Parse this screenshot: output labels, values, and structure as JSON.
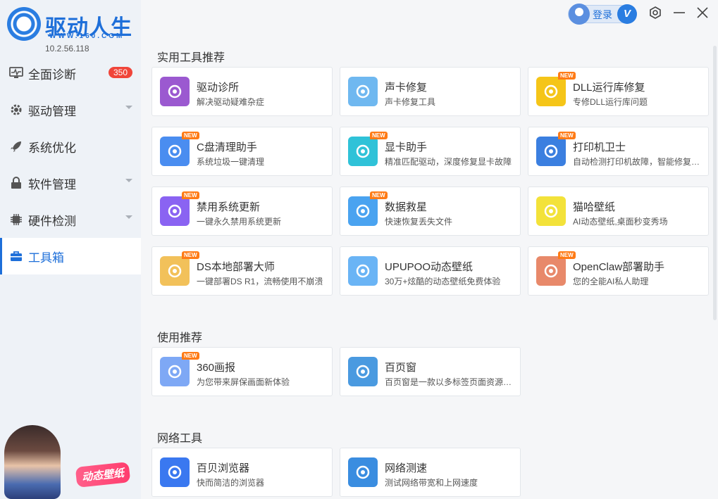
{
  "app": {
    "title": "驱动人生",
    "url": "WWW.160.COM",
    "version": "10.2.56.118"
  },
  "header": {
    "login_label": "登录",
    "vip_label": "V"
  },
  "sidebar": {
    "items": [
      {
        "label": "全面诊断",
        "icon": "monitor-pulse-icon",
        "badge": "350"
      },
      {
        "label": "驱动管理",
        "icon": "gear-icon"
      },
      {
        "label": "系统优化",
        "icon": "rocket-icon"
      },
      {
        "label": "软件管理",
        "icon": "lock-bag-icon"
      },
      {
        "label": "硬件检测",
        "icon": "chip-icon"
      },
      {
        "label": "工具箱",
        "icon": "toolbox-icon",
        "active": true
      }
    ],
    "promo_label": "动态壁纸"
  },
  "sections": {
    "recommended_tools": {
      "title": "实用工具推荐",
      "cards": [
        {
          "title": "驱动诊所",
          "sub": "解决驱动疑难杂症",
          "icon": "doctor-icon",
          "color": "#9b59d0",
          "new": false
        },
        {
          "title": "声卡修复",
          "sub": "声卡修复工具",
          "icon": "speaker-icon",
          "color": "#6fb8f0",
          "new": false
        },
        {
          "title": "DLL运行库修复",
          "sub": "专修DLL运行库问题",
          "icon": "dll-icon",
          "color": "#f5c518",
          "new": true
        },
        {
          "title": "C盘清理助手",
          "sub": "系统垃圾一键清理",
          "icon": "broom-icon",
          "color": "#4a8df0",
          "new": true
        },
        {
          "title": "显卡助手",
          "sub": "精准匹配驱动，深度修复显卡故障",
          "icon": "graphics-card-icon",
          "color": "#2fc2d8",
          "new": true
        },
        {
          "title": "打印机卫士",
          "sub": "自动检测打印机故障，智能修复打印问题",
          "icon": "printer-icon",
          "color": "#3b7fe0",
          "new": true
        },
        {
          "title": "禁用系统更新",
          "sub": "一键永久禁用系统更新",
          "icon": "update-block-icon",
          "color": "#8a63f2",
          "new": true
        },
        {
          "title": "数据救星",
          "sub": "快速恢复丢失文件",
          "icon": "data-recovery-icon",
          "color": "#4aa3f0",
          "new": true
        },
        {
          "title": "猫哈壁纸",
          "sub": "AI动态壁纸,桌面秒变秀场",
          "icon": "cat-icon",
          "color": "#f3e23a",
          "new": false
        },
        {
          "title": "DS本地部署大师",
          "sub": "一键部署DS R1，流畅使用不崩溃",
          "icon": "whale-icon",
          "color": "#f2c15a",
          "new": true
        },
        {
          "title": "UPUPOO动态壁纸",
          "sub": "30万+炫酷的动态壁纸免费体验",
          "icon": "upupoo-icon",
          "color": "#6ab4f5",
          "new": false
        },
        {
          "title": "OpenClaw部署助手",
          "sub": "您的全能AI私人助理",
          "icon": "lobster-icon",
          "color": "#e8896a",
          "new": true
        }
      ]
    },
    "usage_recommended": {
      "title": "使用推荐",
      "cards": [
        {
          "title": "360画报",
          "sub": "为您带来屏保画面新体验",
          "icon": "pictorial-icon",
          "color": "#7ea8f5",
          "new": true
        },
        {
          "title": "百页窗",
          "sub": "百页窗是一款以多标签页面资源管理器",
          "icon": "folder-window-icon",
          "color": "#4a9ae0",
          "new": false
        }
      ]
    },
    "network_tools": {
      "title": "网络工具",
      "cards": [
        {
          "title": "百贝浏览器",
          "sub": "快而简洁的浏览器",
          "icon": "browser-icon",
          "color": "#3a78f0",
          "new": false
        },
        {
          "title": "网络测速",
          "sub": "测试网络带宽和上网速度",
          "icon": "speedometer-icon",
          "color": "#3a8de0",
          "new": false
        }
      ]
    }
  },
  "new_tag": "NEW"
}
